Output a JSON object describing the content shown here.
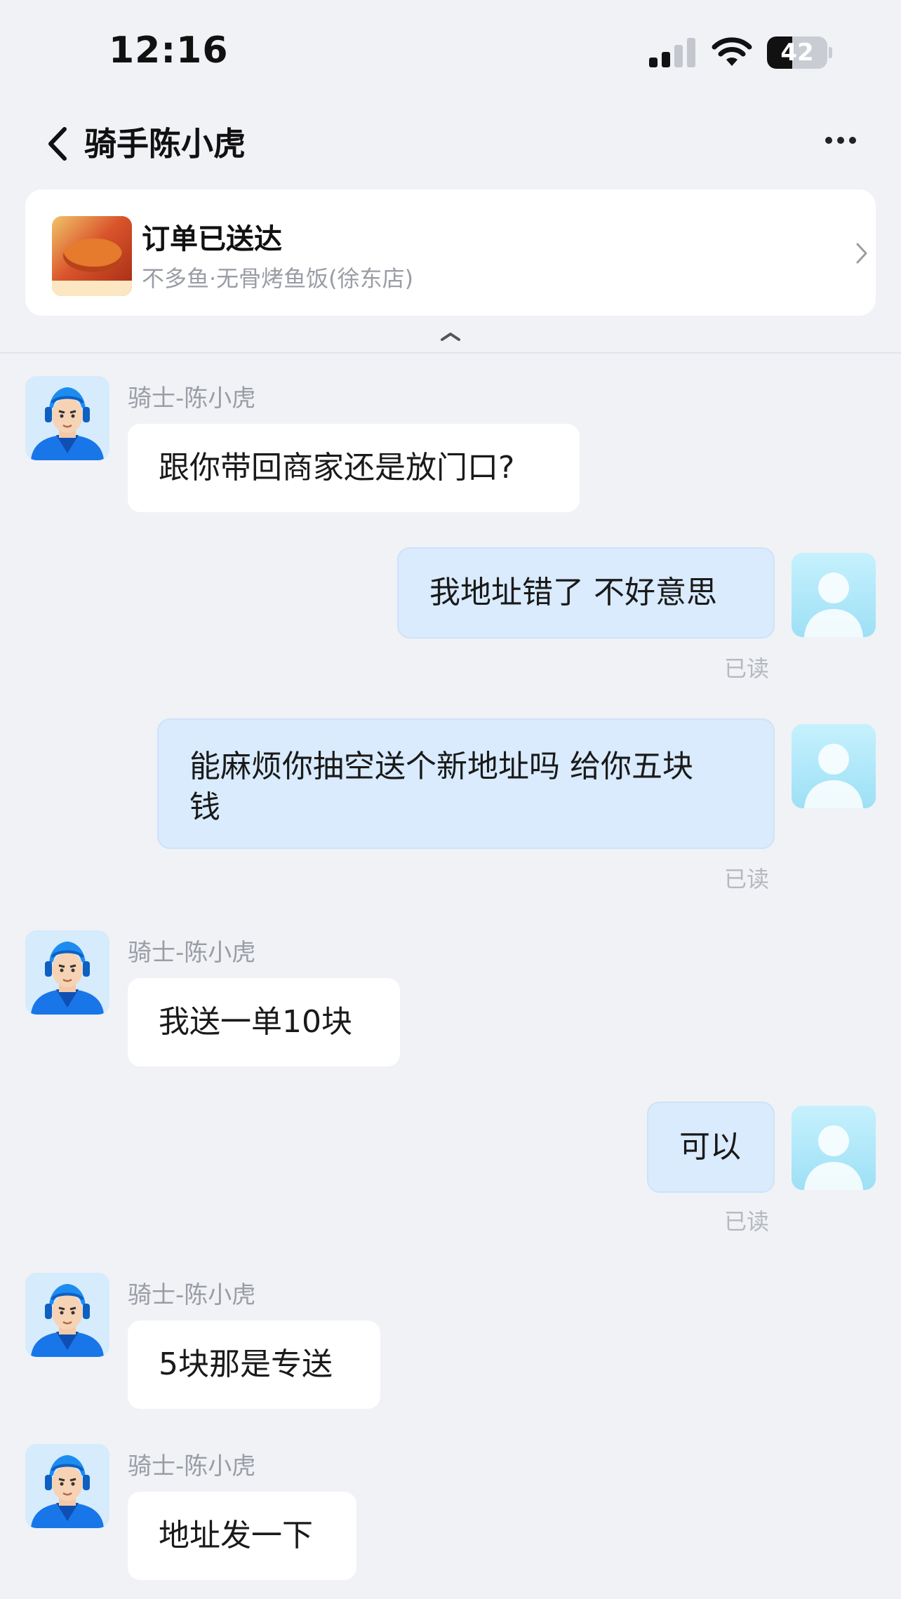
{
  "status_bar": {
    "time": "12:16",
    "battery": "42",
    "battery_level": 0.42
  },
  "nav": {
    "title": "骑手陈小虎",
    "back_icon": "chevron-left-icon",
    "more_icon": "more-horizontal-icon"
  },
  "order_card": {
    "status": "订单已送达",
    "shop": "不多鱼·无骨烤鱼饭(徐东店)",
    "icon": "chevron-right-icon"
  },
  "colors": {
    "background": "#f0f2f6",
    "outgoing_bubble": "#d9ebfd",
    "incoming_bubble": "#ffffff",
    "muted_text": "#9a9da5"
  },
  "messages": [
    {
      "from": "rider",
      "sender": "骑士-陈小虎",
      "text": "跟你带回商家还是放门口?"
    },
    {
      "from": "me",
      "text": "我地址错了 不好意思",
      "read": "已读"
    },
    {
      "from": "me",
      "text_line1": "能麻烦你抽空送个新地址吗 给你五块",
      "text_line2": "钱",
      "read": "已读"
    },
    {
      "from": "rider",
      "sender": "骑士-陈小虎",
      "text": "我送一单10块"
    },
    {
      "from": "me",
      "text": "可以",
      "read": "已读"
    },
    {
      "from": "rider",
      "sender": "骑士-陈小虎",
      "text": "5块那是专送"
    },
    {
      "from": "rider",
      "sender": "骑士-陈小虎",
      "text": "地址发一下"
    }
  ]
}
